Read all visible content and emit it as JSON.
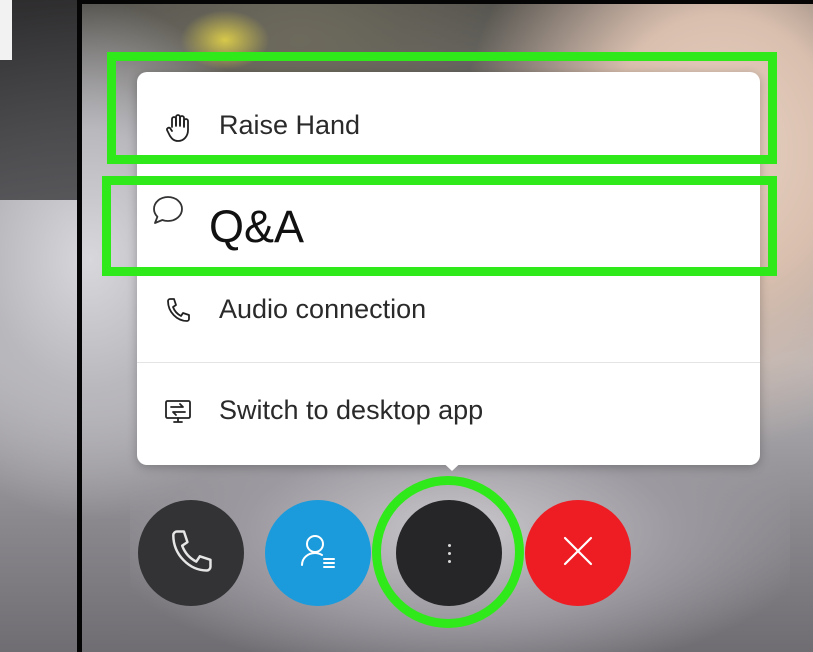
{
  "menu": {
    "items": [
      {
        "label": "Raise Hand",
        "icon": "hand-icon"
      },
      {
        "label": "Q&A",
        "icon": "speech-bubble-icon"
      },
      {
        "label": "Audio connection",
        "icon": "phone-icon"
      },
      {
        "label": "Switch to desktop app",
        "icon": "desktop-switch-icon"
      }
    ]
  },
  "controls": {
    "audio": {
      "icon": "phone-icon"
    },
    "participants": {
      "icon": "participants-icon"
    },
    "more": {
      "icon": "more-vertical-icon"
    },
    "leave": {
      "icon": "close-icon"
    }
  },
  "colors": {
    "highlight": "#2fe91a",
    "participants_button": "#1b9bdc",
    "leave_button": "#ee1d24",
    "dark_button": "#333335"
  }
}
